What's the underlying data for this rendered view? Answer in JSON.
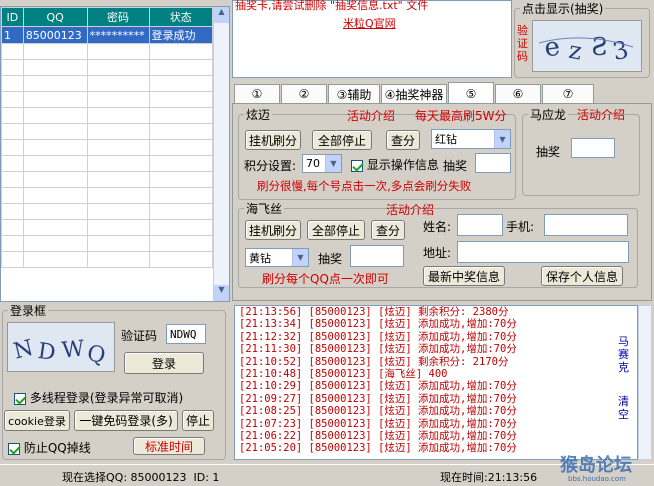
{
  "table": {
    "headers": [
      "ID",
      "QQ",
      "密码",
      "状态"
    ],
    "rows": [
      [
        "1",
        "85000123",
        "**********",
        "登录成功"
      ]
    ]
  },
  "top_text": {
    "line1": "抽奖卡,请尝试删除 \"抽奖信息.txt\" 文件",
    "link": "米粒Q官网"
  },
  "captcha_group": {
    "label": "点击显示(抽奖)",
    "side_label": "验证码"
  },
  "tabs": [
    "①",
    "②",
    "③辅助",
    "④抽奖神器",
    "⑤",
    "⑥",
    "⑦"
  ],
  "xuanmai": {
    "label": "炫迈",
    "activity": "活动介绍",
    "max_note": "每天最高刷5W分",
    "btn_hang": "挂机刷分",
    "btn_stop": "全部停止",
    "btn_query": "查分",
    "select_value": "红钻",
    "score_label": "积分设置:",
    "score_value": "70",
    "show_info": "显示操作信息",
    "draw_label": "抽奖",
    "note": "刷分很慢,每个号点击一次,多点会刷分失败"
  },
  "mayinglong": {
    "label": "马应龙",
    "activity": "活动介绍",
    "draw_label": "抽奖"
  },
  "haifeisi": {
    "label": "海飞丝",
    "activity": "活动介绍",
    "btn_hang": "挂机刷分",
    "btn_stop": "全部停止",
    "btn_query": "查分",
    "select_value": "黄钻",
    "draw_label": "抽奖",
    "note": "刷分每个QQ点一次即可",
    "name_label": "姓名:",
    "phone_label": "手机:",
    "addr_label": "地址:",
    "btn_latest": "最新中奖信息",
    "btn_save": "保存个人信息"
  },
  "login": {
    "label": "登录框",
    "captcha_label": "验证码",
    "captcha_value": "NDWQ",
    "login_btn": "登录",
    "multithread": "多线程登录(登录异常可取消)",
    "cookie_btn": "cookie登录",
    "oneclick_btn": "一键免码登录(多)",
    "stop_btn": "停止",
    "prevent_drop": "防止QQ掉线",
    "std_time": "标准时间"
  },
  "log_lines": [
    "[21:13:56] [85000123] [炫迈] 剩余积分: 2380分",
    "[21:13:34] [85000123] [炫迈] 添加成功,增加:70分",
    "[21:12:32] [85000123] [炫迈] 添加成功,增加:70分",
    "[21:11:30] [85000123] [炫迈] 添加成功,增加:70分",
    "[21:10:52] [85000123] [炫迈] 剩余积分: 2170分",
    "[21:10:48] [85000123] [海飞丝] 400",
    "[21:10:29] [85000123] [炫迈] 添加成功,增加:70分",
    "[21:09:27] [85000123] [炫迈] 添加成功,增加:70分",
    "[21:08:25] [85000123] [炫迈] 添加成功,增加:70分",
    "[21:07:23] [85000123] [炫迈] 添加成功,增加:70分",
    "[21:06:22] [85000123] [炫迈] 添加成功,增加:70分",
    "[21:05:20] [85000123] [炫迈] 添加成功,增加:70分"
  ],
  "side_links": {
    "horse": "马赛克",
    "clear": "清空"
  },
  "status": {
    "selected": "现在选择QQ: 85000123  ID: 1",
    "time": "现在时间:21:13:56"
  },
  "watermark": {
    "text": "猴岛论坛",
    "url": "bbs.houdao.com"
  }
}
